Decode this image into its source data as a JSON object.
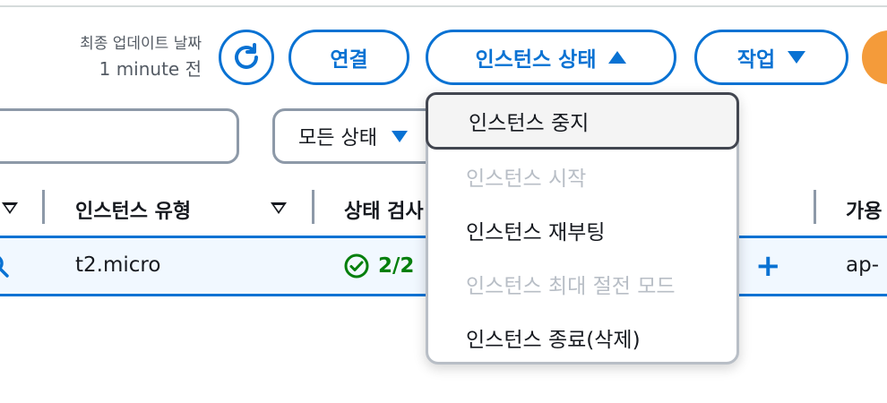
{
  "header": {
    "last_updated_label": "최종 업데이트 날짜",
    "last_updated_value": "1 minute 전",
    "refresh_icon": "refresh-icon",
    "connect_label": "연결",
    "instance_state_label": "인스턴스 상태",
    "actions_label": "작업"
  },
  "filters": {
    "search_value": "",
    "state_filter_label": "모든 상태"
  },
  "table": {
    "columns": [
      "인스턴스 유형",
      "상태 검사",
      "가용"
    ],
    "row": {
      "instance_type": "t2.micro",
      "status_check": "2/2",
      "availability_zone": "ap-"
    }
  },
  "menu": {
    "items": [
      {
        "label": "인스턴스 중지",
        "disabled": false,
        "highlighted": true
      },
      {
        "label": "인스턴스 시작",
        "disabled": true
      },
      {
        "label": "인스턴스 재부팅",
        "disabled": false
      },
      {
        "label": "인스턴스 최대 절전 모드",
        "disabled": true
      },
      {
        "label": "인스턴스 종료(삭제)",
        "disabled": false
      }
    ]
  },
  "colors": {
    "accent": "#0972d3",
    "success": "#037f0c",
    "disabled": "#b8bec6",
    "orange": "#f49b3a"
  }
}
